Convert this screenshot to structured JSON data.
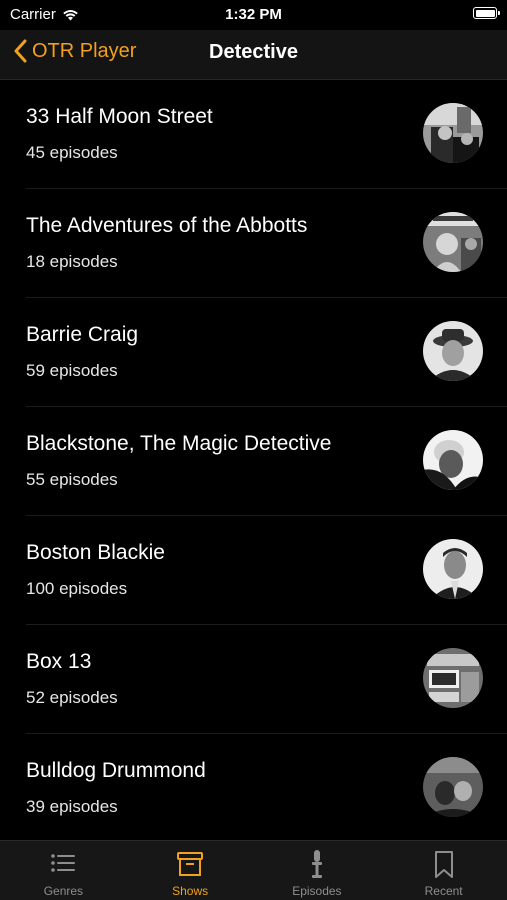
{
  "status_bar": {
    "carrier": "Carrier",
    "time": "1:32 PM"
  },
  "nav": {
    "back_label": "OTR Player",
    "title": "Detective"
  },
  "accent_color": "#f0a11e",
  "shows": [
    {
      "title": "33 Half Moon Street",
      "episodes": "45 episodes",
      "thumb_icon": "show-artwork"
    },
    {
      "title": "The Adventures of the Abbotts",
      "episodes": "18 episodes",
      "thumb_icon": "show-artwork"
    },
    {
      "title": "Barrie Craig",
      "episodes": "59 episodes",
      "thumb_icon": "show-artwork"
    },
    {
      "title": "Blackstone, The Magic Detective",
      "episodes": "55 episodes",
      "thumb_icon": "show-artwork"
    },
    {
      "title": "Boston Blackie",
      "episodes": "100 episodes",
      "thumb_icon": "show-artwork"
    },
    {
      "title": "Box 13",
      "episodes": "52 episodes",
      "thumb_icon": "show-artwork"
    },
    {
      "title": "Bulldog Drummond",
      "episodes": "39 episodes",
      "thumb_icon": "show-artwork"
    }
  ],
  "tabs": [
    {
      "label": "Genres",
      "icon": "list-icon",
      "active": false
    },
    {
      "label": "Shows",
      "icon": "archive-box-icon",
      "active": true
    },
    {
      "label": "Episodes",
      "icon": "microphone-icon",
      "active": false
    },
    {
      "label": "Recent",
      "icon": "bookmark-icon",
      "active": false
    }
  ]
}
